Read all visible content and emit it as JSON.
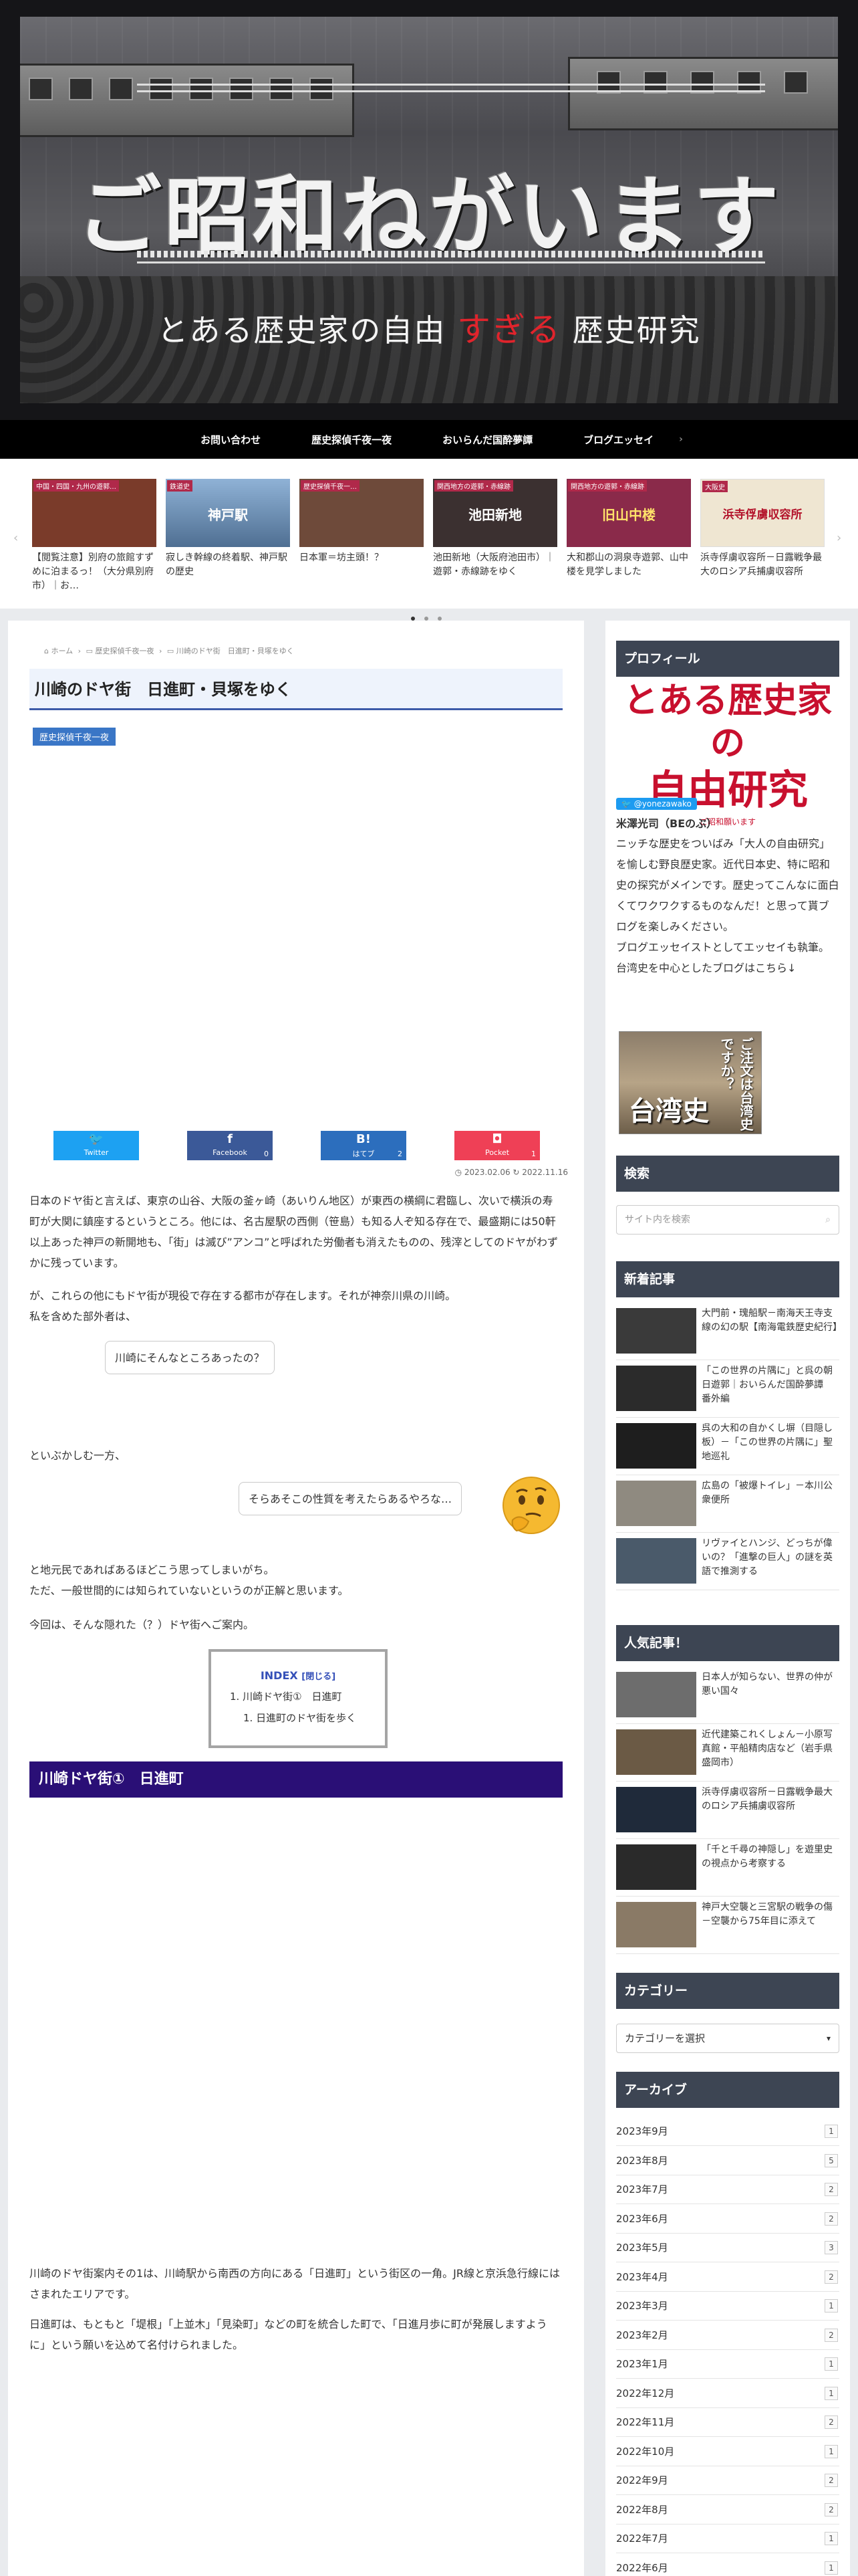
{
  "header": {
    "site_title": "ご昭和ねがいます",
    "subtitle_before": "とある歴史家の自由",
    "subtitle_emph": "すぎる",
    "subtitle_after": "歴史研究"
  },
  "nav": {
    "items": [
      "お問い合わせ",
      "歴史探偵千夜一夜",
      "おいらんだ国酔夢譚",
      "ブログエッセイ"
    ],
    "more": "›"
  },
  "carousel": {
    "items": [
      {
        "tag": "中国・四国・九州の遊郭…",
        "thumb_title": "",
        "caption": "【閲覧注意】別府の旅館すずめに泊まるっ！（大分県別府市）｜お…",
        "color": "#7a3b2a"
      },
      {
        "tag": "鉄道史",
        "thumb_title": "神戸駅",
        "caption": "寂しき幹線の終着駅、神戸駅の歴史",
        "color": "#5b7fa6"
      },
      {
        "tag": "歴史探偵千夜一…",
        "thumb_title": "",
        "caption": "日本軍＝坊主頭！？",
        "color": "#6e4a3a"
      },
      {
        "tag": "関西地方の遊郭・赤線跡",
        "thumb_title": "池田新地",
        "caption": "池田新地（大阪府池田市）｜遊郭・赤線跡をゆく",
        "color": "#3b3030"
      },
      {
        "tag": "関西地方の遊郭・赤線跡",
        "thumb_title": "旧山中楼",
        "caption": "大和郡山の洞泉寺遊郭、山中楼を見学しました",
        "color": "#8a2a4a"
      },
      {
        "tag": "大阪史",
        "thumb_title": "浜寺俘虜収容所",
        "caption": "浜寺俘虜収容所－日露戦争最大のロシア兵捕虜収容所",
        "color": "#efe6d2"
      }
    ],
    "prev": "‹",
    "next": "›"
  },
  "breadcrumb": [
    "⌂ ホーム",
    "›",
    "▭ 歴史探偵千夜一夜",
    "›",
    "▭ 川崎のドヤ街　日進町・貝塚をゆく"
  ],
  "post": {
    "title": "川崎のドヤ街　日進町・貝塚をゆく",
    "category": "歴史探偵千夜一夜",
    "share": [
      {
        "icon": "🐦",
        "label": "Twitter",
        "count": "",
        "color": "#1da1f2"
      },
      {
        "icon": "f",
        "label": "Facebook",
        "count": "0",
        "color": "#3b5998"
      },
      {
        "icon": "B!",
        "label": "はてブ",
        "count": "2",
        "color": "#2c6ebd"
      },
      {
        "icon": "◘",
        "label": "Pocket",
        "count": "1",
        "color": "#ef4056"
      }
    ],
    "date_published": "◷ 2023.02.06",
    "date_updated": "↻ 2022.11.16",
    "p1": "日本のドヤ街と言えば、東京の山谷、大阪の釜ヶ崎（あいりん地区）が東西の横綱に君臨し、次いで横浜の寿町が大関に鎮座するというところ。他には、名古屋駅の西側（笹島）も知る人ぞ知る存在で、最盛期には50軒以上あった神戸の新開地も、「街」は滅び”アンコ”と呼ばれた労働者も消えたものの、残滓としてのドヤがわずかに残っています。",
    "p2a": "が、これらの他にもドヤ街が現役で存在する都市が存在します。それが神奈川県の川崎。",
    "p2b": "私を含めた部外者は、",
    "bubble1": "川崎にそんなところあったの？",
    "p3": "といぶかしむ一方、",
    "bubble2": "そらあそこの性質を考えたらあるやろな…",
    "thinker_icon": "🤔",
    "p4a": "と地元民であればあるほどこう思ってしまいがち。",
    "p4b": "ただ、一般世間的には知られていないというのが正解と思います。",
    "p5": "今回は、そんな隠れた（？）ドヤ街へご案内。",
    "toc": {
      "title": "INDEX",
      "toggle": "[閉じる]",
      "items": [
        "1. 川崎ドヤ街①　日進町",
        "1. 日進町のドヤ街を歩く"
      ]
    },
    "h2": "川崎ドヤ街①　日進町",
    "p6": "川崎のドヤ街案内その1は、川崎駅から南西の方向にある「日進町」という街区の一角。JR線と京浜急行線にはさまれたエリアです。",
    "p7": "日進町は、もともと「堤根」「上並木」「見染町」などの町を統合した町で、「日進月歩に町が発展しますように」という願いを込めて名付けられました。"
  },
  "sidebar": {
    "profile": {
      "heading": "プロフィール",
      "logo_line1": "とある歴史家の",
      "logo_line2": "自由研究",
      "logo_line3": "ご昭和願います",
      "twitter_follow": "🐦 @yonezawako",
      "name": "米澤光司（BEのぶ）",
      "bio": "ニッチな歴史をついばみ「大人の自由研究」を愉しむ野良歴史家。近代日本史、特に昭和史の探究がメインです。歴史ってこんなに面白くてワクワクするものなんだ！と思って貰ブログを楽しみください。",
      "essay": "ブログエッセイストとしてエッセイも執筆。",
      "taiwan_link": "台湾史を中心としたブログはこちら↓",
      "banner_main": "台湾史",
      "banner_side": "ご注文は台湾史ですか？"
    },
    "search": {
      "heading": "検索",
      "placeholder": "サイト内を検索",
      "icon": "⌕"
    },
    "new_posts": {
      "heading": "新着記事",
      "items": [
        {
          "title": "大門前・瑰船駅－南海天王寺支線の幻の駅【南海電鉄歴史紀行】",
          "color": "#3a3a3a"
        },
        {
          "title": "「この世界の片隅に」と呉の朝日遊郭｜おいらんだ国酔夢譚　番外編",
          "color": "#2b2b2b"
        },
        {
          "title": "呉の大和の自かくし塀（目隠し板）－「この世界の片隅に」聖地巡礼",
          "color": "#1e1e1e"
        },
        {
          "title": "広島の「被爆トイレ」－本川公衆便所",
          "color": "#8f8a80"
        },
        {
          "title": "リヴァイとハンジ、どっちが偉いの？「進撃の巨人」の謎を英語で推測する",
          "color": "#4a5a6a"
        }
      ]
    },
    "popular": {
      "heading": "人気記事！",
      "items": [
        {
          "title": "日本人が知らない、世界の仲が悪い国々",
          "color": "#6d6d6d"
        },
        {
          "title": "近代建築これくしょん－小原写真館・平船精肉店など（岩手県盛岡市）",
          "color": "#6b5a45"
        },
        {
          "title": "浜寺俘虜収容所－日露戦争最大のロシア兵捕虜収容所",
          "color": "#1f2a3a"
        },
        {
          "title": "「千と千尋の神隠し」を遊里史の視点から考察する",
          "color": "#2a2a2a"
        },
        {
          "title": "神戸大空襲と三宮駅の戦争の傷－空襲から75年目に添えて",
          "color": "#8a7a66"
        }
      ]
    },
    "categories": {
      "heading": "カテゴリー",
      "select_label": "カテゴリーを選択",
      "icon": "▾"
    },
    "archive": {
      "heading": "アーカイブ",
      "rows": [
        {
          "label": "2023年9月",
          "count": "1"
        },
        {
          "label": "2023年8月",
          "count": "5"
        },
        {
          "label": "2023年7月",
          "count": "2"
        },
        {
          "label": "2023年6月",
          "count": "2"
        },
        {
          "label": "2023年5月",
          "count": "3"
        },
        {
          "label": "2023年4月",
          "count": "2"
        },
        {
          "label": "2023年3月",
          "count": "1"
        },
        {
          "label": "2023年2月",
          "count": "2"
        },
        {
          "label": "2023年1月",
          "count": "1"
        },
        {
          "label": "2022年12月",
          "count": "1"
        },
        {
          "label": "2022年11月",
          "count": "2"
        },
        {
          "label": "2022年10月",
          "count": "1"
        },
        {
          "label": "2022年9月",
          "count": "2"
        },
        {
          "label": "2022年8月",
          "count": "2"
        },
        {
          "label": "2022年7月",
          "count": "1"
        },
        {
          "label": "2022年6月",
          "count": "1"
        }
      ]
    }
  }
}
